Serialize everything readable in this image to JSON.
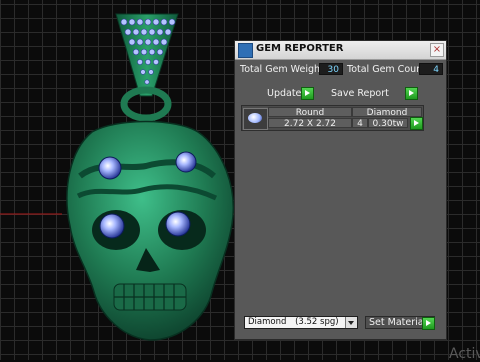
{
  "window": {
    "title": "GEM REPORTER",
    "close_glyph": "×"
  },
  "totals": {
    "weight_label": "Total Gem Weight",
    "weight_value": "30",
    "count_label": "Total Gem Count",
    "count_value": "4"
  },
  "slider_position": 0.62,
  "buttons": {
    "update": "Update",
    "save_report": "Save Report",
    "set_material": "Set Material"
  },
  "gem_table": {
    "row_headers": [
      "Round",
      "Diamond"
    ],
    "values": {
      "size": "2.72 X 2.72",
      "count": "4",
      "weight": "0.30tw"
    }
  },
  "material": {
    "selected": "Diamond",
    "density": "(3.52 spg)"
  },
  "watermark": "Activ",
  "colors": {
    "model_green": "#1f7a52",
    "gem_blue": "#a8b8ff",
    "panel_bg": "#585858",
    "button_green": "#2db82d"
  },
  "icons": [
    "gem-reporter-app-icon",
    "close-icon",
    "play-icon",
    "gem-thumbnail-icon",
    "dropdown-icon"
  ]
}
